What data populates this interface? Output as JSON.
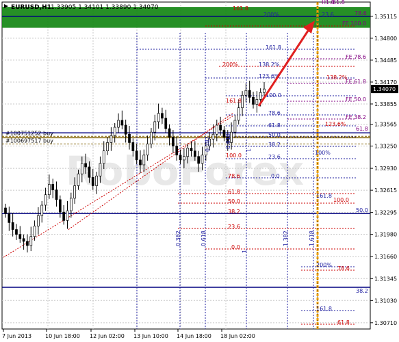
{
  "header": {
    "symbol": "EURUSD,H1",
    "ohlc": "1.33905 1.34101 1.33890 1.34070"
  },
  "watermark": "RoboForex",
  "colors": {
    "candle": "#000000",
    "fib_red": "#cc0000",
    "fib_blue": "#2020a0",
    "fib_purple": "#800080",
    "level_line": "#000080",
    "green_zone": "#1a8a1a",
    "arrow": "#e02020",
    "timeline": "#f0a000"
  },
  "chart_data": {
    "type": "candlestick",
    "y_axis": {
      "ylim": [
        1.3062,
        1.3532
      ],
      "ticks": [
        "1.35115",
        "1.34800",
        "1.34485",
        "1.34170",
        "1.33855",
        "1.33565",
        "1.33250",
        "1.32930",
        "1.32615",
        "1.32295",
        "1.31980",
        "1.31660",
        "1.31345",
        "1.31030",
        "1.30710"
      ],
      "current_price": "1.34070"
    },
    "x_axis": {
      "ticks": [
        "7 Jun 2013",
        "10 Jun 18:00",
        "12 Jun 02:00",
        "13 Jun 10:00",
        "14 Jun 18:00",
        "18 Jun 02:00"
      ]
    },
    "series_close": [
      1.3228,
      1.3215,
      1.3205,
      1.3198,
      1.3192,
      1.3188,
      1.3182,
      1.3195,
      1.321,
      1.3225,
      1.324,
      1.3255,
      1.327,
      1.3262,
      1.3248,
      1.323,
      1.3218,
      1.3232,
      1.325,
      1.3268,
      1.3285,
      1.33,
      1.3295,
      1.328,
      1.3268,
      1.3282,
      1.33,
      1.3318,
      1.333,
      1.334,
      1.3352,
      1.3362,
      1.3355,
      1.3342,
      1.333,
      1.3318,
      1.3305,
      1.3298,
      1.3312,
      1.3328,
      1.3345,
      1.336,
      1.3372,
      1.3365,
      1.335,
      1.3338,
      1.3325,
      1.3312,
      1.3305,
      1.331,
      1.3322,
      1.3318,
      1.331,
      1.33,
      1.3312,
      1.3325,
      1.3335,
      1.3342,
      1.3355,
      1.3348,
      1.3338,
      1.333,
      1.3345,
      1.3362,
      1.338,
      1.3398,
      1.3405,
      1.3395,
      1.3385,
      1.3392,
      1.3402,
      1.3407
    ],
    "horizontal_levels": [
      {
        "value": 1.35115,
        "label": "",
        "color": "#000080"
      },
      {
        "value": 1.3339,
        "label": "#100751252 buy",
        "color": "#806000"
      },
      {
        "value": 1.3337,
        "label": "",
        "color": "#806000"
      },
      {
        "value": 1.3344,
        "label": "",
        "color": "#000080"
      },
      {
        "value": 1.3328,
        "label": "#100697517 buy",
        "color": "#806000"
      },
      {
        "value": 1.3228,
        "label": "",
        "color": "#000080"
      },
      {
        "value": 1.3122,
        "label": "",
        "color": "#000080"
      }
    ],
    "green_zone": [
      1.3495,
      1.3525
    ],
    "fib_labels": [
      {
        "text": "161.8",
        "color": "#cc0000",
        "x": 340,
        "y": 15
      },
      {
        "text": "200%",
        "color": "#2020a0",
        "x": 385,
        "y": 24
      },
      {
        "text": "23.6",
        "color": "#2020a0",
        "x": 470,
        "y": 24
      },
      {
        "text": "78.6",
        "color": "#800080",
        "x": 518,
        "y": 22
      },
      {
        "text": "FE 100.0",
        "color": "#800080",
        "x": 500,
        "y": 37
      },
      {
        "text": "61.8",
        "color": "#800080",
        "x": 486,
        "y": 6
      },
      {
        "text": "H1.8",
        "color": "#800080",
        "x": 470,
        "y": 6
      },
      {
        "text": "161.8",
        "color": "#2020a0",
        "x": 388,
        "y": 72
      },
      {
        "text": "FE 78.6",
        "color": "#800080",
        "x": 505,
        "y": 86
      },
      {
        "text": "200%",
        "color": "#cc0000",
        "x": 325,
        "y": 97
      },
      {
        "text": "138.2%",
        "color": "#2020a0",
        "x": 378,
        "y": 97
      },
      {
        "text": "123.6%",
        "color": "#2020a0",
        "x": 378,
        "y": 114
      },
      {
        "text": "138.2%",
        "color": "#cc0000",
        "x": 477,
        "y": 116
      },
      {
        "text": "FE 61.8",
        "color": "#800080",
        "x": 505,
        "y": 122
      },
      {
        "text": "100.0",
        "color": "#2020a0",
        "x": 388,
        "y": 142
      },
      {
        "text": "161.8",
        "color": "#cc0000",
        "x": 330,
        "y": 150
      },
      {
        "text": "FE 50.0",
        "color": "#800080",
        "x": 505,
        "y": 148
      },
      {
        "text": "78.6",
        "color": "#2020a0",
        "x": 392,
        "y": 168
      },
      {
        "text": "FE 38.2",
        "color": "#800080",
        "x": 505,
        "y": 174
      },
      {
        "text": "123.6%",
        "color": "#cc0000",
        "x": 475,
        "y": 184
      },
      {
        "text": "61.8",
        "color": "#2020a0",
        "x": 392,
        "y": 186
      },
      {
        "text": "61.8",
        "color": "#800080",
        "x": 520,
        "y": 191
      },
      {
        "text": "50.0",
        "color": "#2020a0",
        "x": 392,
        "y": 200
      },
      {
        "text": "38.2",
        "color": "#2020a0",
        "x": 392,
        "y": 214
      },
      {
        "text": "100%",
        "color": "#2020a0",
        "x": 460,
        "y": 226
      },
      {
        "text": "100.0",
        "color": "#cc0000",
        "x": 330,
        "y": 230
      },
      {
        "text": "23.6",
        "color": "#2020a0",
        "x": 392,
        "y": 232
      },
      {
        "text": "78.6",
        "color": "#cc0000",
        "x": 333,
        "y": 260
      },
      {
        "text": "0.0",
        "color": "#2020a0",
        "x": 396,
        "y": 260
      },
      {
        "text": "61.8",
        "color": "#cc0000",
        "x": 333,
        "y": 283
      },
      {
        "text": "161.8",
        "color": "#2020a0",
        "x": 462,
        "y": 289
      },
      {
        "text": "50.0",
        "color": "#cc0000",
        "x": 333,
        "y": 297
      },
      {
        "text": "100.0",
        "color": "#cc0000",
        "x": 487,
        "y": 295
      },
      {
        "text": "50.0",
        "color": "#2020a0",
        "x": 520,
        "y": 310
      },
      {
        "text": "38.2",
        "color": "#cc0000",
        "x": 333,
        "y": 312
      },
      {
        "text": "23.6",
        "color": "#cc0000",
        "x": 333,
        "y": 334
      },
      {
        "text": "0.0",
        "color": "#cc0000",
        "x": 338,
        "y": 364
      },
      {
        "text": "200%",
        "color": "#2020a0",
        "x": 462,
        "y": 390
      },
      {
        "text": "78.6",
        "color": "#cc0000",
        "x": 493,
        "y": 395
      },
      {
        "text": "38.2",
        "color": "#2020a0",
        "x": 520,
        "y": 428
      },
      {
        "text": "161.8",
        "color": "#2020a0",
        "x": 462,
        "y": 454
      },
      {
        "text": "61.8",
        "color": "#cc0000",
        "x": 493,
        "y": 474
      }
    ],
    "time_zone_labels": [
      {
        "text": "0.382",
        "x": 263,
        "y": 360
      },
      {
        "text": "0.618",
        "x": 300,
        "y": 360
      },
      {
        "text": "1",
        "x": 360,
        "y": 370
      },
      {
        "text": "1.382",
        "x": 420,
        "y": 360
      },
      {
        "text": "1.618",
        "x": 458,
        "y": 360
      },
      {
        "text": "0.382",
        "x": 306,
        "y": 222
      },
      {
        "text": "0.618",
        "x": 336,
        "y": 218
      },
      {
        "text": "1",
        "x": 366,
        "y": 222
      }
    ]
  }
}
